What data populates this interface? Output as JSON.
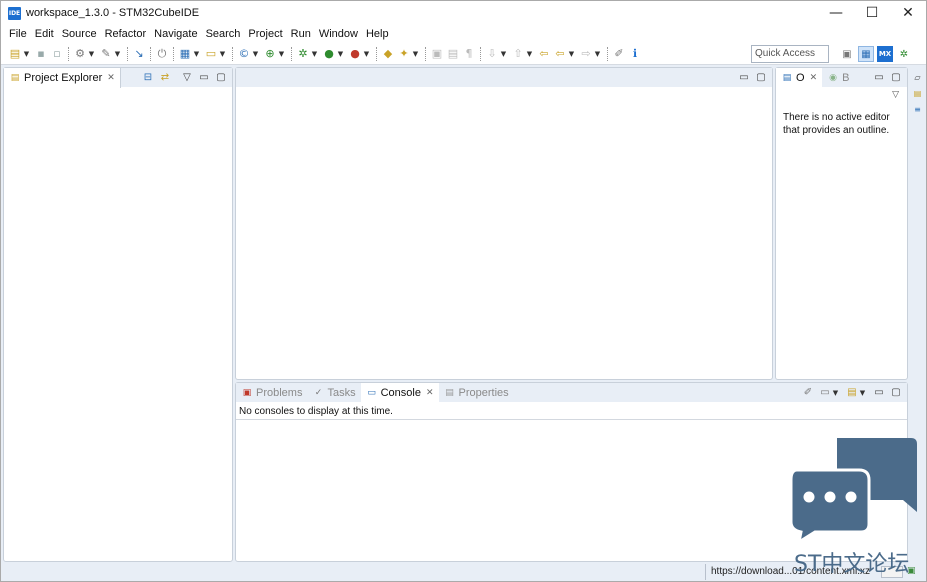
{
  "window": {
    "app_icon_text": "IDE",
    "title": "workspace_1.3.0 - STM32CubeIDE",
    "controls": {
      "minimize": "—",
      "maximize": "☐",
      "close": "✕"
    }
  },
  "menu": [
    "File",
    "Edit",
    "Source",
    "Refactor",
    "Navigate",
    "Search",
    "Project",
    "Run",
    "Window",
    "Help"
  ],
  "toolbar": {
    "quick_access_placeholder": "Quick Access",
    "perspective_mx_label": "MX"
  },
  "explorer": {
    "tab_label": "Project Explorer",
    "close_glyph": "✕"
  },
  "outline": {
    "tab1_label": "O",
    "tab2_label": "B",
    "close_glyph": "✕",
    "message": "There is no active editor that provides an outline."
  },
  "console": {
    "tabs": [
      {
        "label": "Problems",
        "active": false
      },
      {
        "label": "Tasks",
        "active": false
      },
      {
        "label": "Console",
        "active": true
      },
      {
        "label": "Properties",
        "active": false
      }
    ],
    "close_glyph": "✕",
    "message": "No consoles to display at this time."
  },
  "status": {
    "url": "https://download...01/content.xml.xz"
  },
  "watermark": {
    "text": "ST中文论坛"
  },
  "colors": {
    "accent": "#1d6fd0",
    "chrome_bg": "#e8eef6",
    "watermark": "#4b6b8a"
  }
}
